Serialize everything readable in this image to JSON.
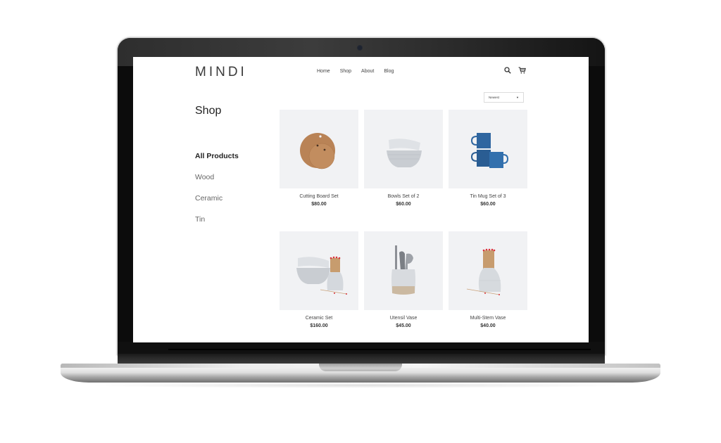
{
  "site": {
    "logo": "MINDI",
    "nav": [
      "Home",
      "Shop",
      "About",
      "Blog"
    ],
    "icons": [
      "search-icon",
      "cart-icon"
    ]
  },
  "sort": {
    "selected": "Newest"
  },
  "page_title": "Shop",
  "categories": [
    {
      "label": "All Products",
      "active": true
    },
    {
      "label": "Wood",
      "active": false
    },
    {
      "label": "Ceramic",
      "active": false
    },
    {
      "label": "Tin",
      "active": false
    }
  ],
  "products": [
    {
      "name": "Cutting Board Set",
      "price": "$80.00",
      "image": "cutting-boards"
    },
    {
      "name": "Bowls Set of 2",
      "price": "$60.00",
      "image": "bowls"
    },
    {
      "name": "Tin Mug Set of 3",
      "price": "$60.00",
      "image": "tin-mugs"
    },
    {
      "name": "Ceramic Set",
      "price": "$160.00",
      "image": "ceramic-set"
    },
    {
      "name": "Utensil Vase",
      "price": "$45.00",
      "image": "utensil-vase"
    },
    {
      "name": "Multi-Stem Vase",
      "price": "$40.00",
      "image": "multi-stem-vase"
    }
  ],
  "colors": {
    "tile_bg": "#f1f2f4",
    "wood": "#b98356",
    "tin_blue": "#2f66a0",
    "ceramic": "#d4d8dd",
    "match_tip": "#d9323a"
  }
}
